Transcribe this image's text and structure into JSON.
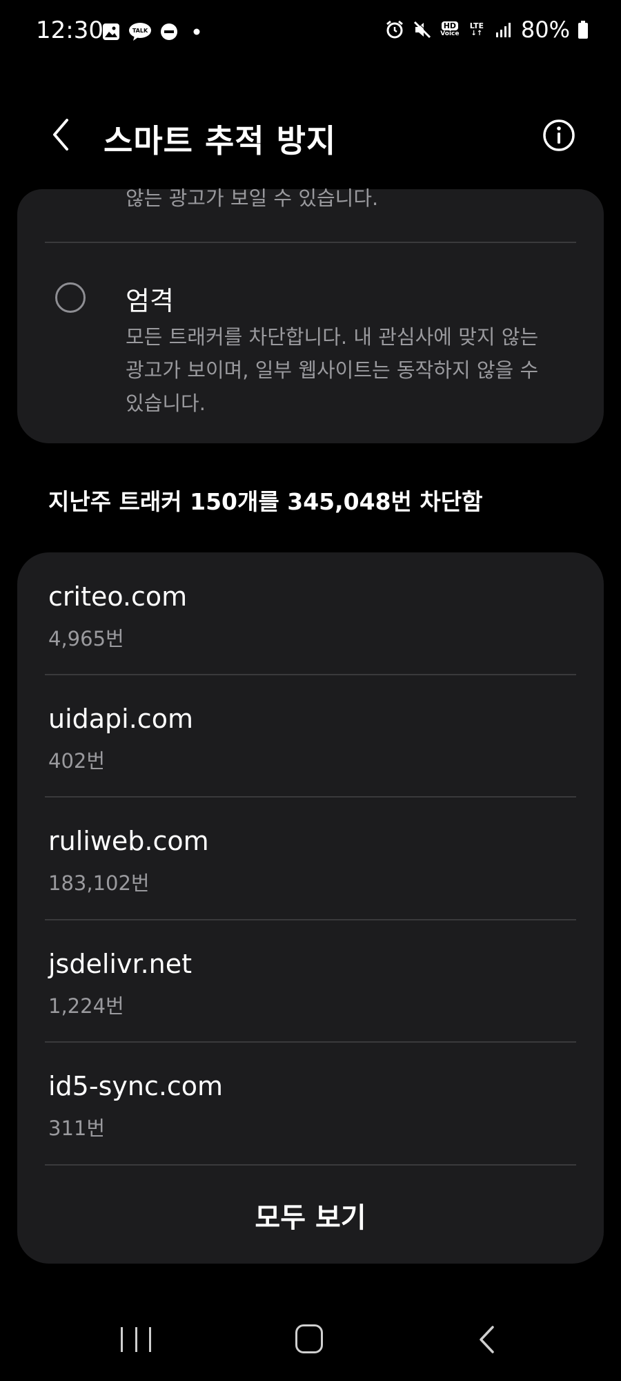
{
  "status_bar": {
    "time": "12:30",
    "left_icons": [
      "image-icon",
      "kakaotalk-icon",
      "do-not-disturb-icon",
      "dot-icon"
    ],
    "right_icons": [
      "alarm-icon",
      "mute-icon",
      "hd-voice-icon",
      "lte-icon",
      "signal-icon",
      "battery-icon"
    ],
    "talk_label": "TALK",
    "hd_label": "HD",
    "voice_label": "Voice",
    "lte_label": "LTE",
    "battery": "80%"
  },
  "header": {
    "title": "스마트 추적 방지"
  },
  "protection_options": {
    "previous_option_desc_tail": "않는 광고가 보일 수 있습니다.",
    "strict": {
      "title": "엄격",
      "description": "모든 트래커를 차단합니다. 내 관심사에 맞지 않는 광고가 보이며, 일부 웹사이트는 동작하지 않을 수 있습니다.",
      "selected": false
    }
  },
  "summary": "지난주 트래커 150개를 345,048번 차단함",
  "trackers": [
    {
      "domain": "criteo.com",
      "count": "4,965번"
    },
    {
      "domain": "uidapi.com",
      "count": "402번"
    },
    {
      "domain": "ruliweb.com",
      "count": "183,102번"
    },
    {
      "domain": "jsdelivr.net",
      "count": "1,224번"
    },
    {
      "domain": "id5-sync.com",
      "count": "311번"
    }
  ],
  "view_all_label": "모두 보기",
  "colors": {
    "background": "#000000",
    "card": "#1c1c1e",
    "secondary_text": "#9a9a9e",
    "divider": "#3a3a3c"
  }
}
